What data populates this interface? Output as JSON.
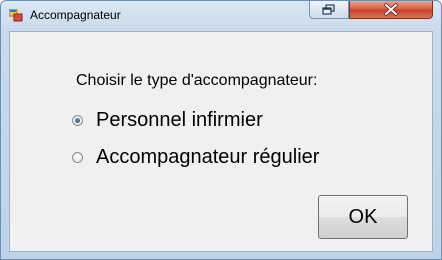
{
  "window": {
    "title": "Accompagnateur",
    "app_icon": "app-window-icon",
    "controls": {
      "restore_icon": "restore-icon",
      "close_icon": "close-icon"
    }
  },
  "dialog": {
    "prompt": "Choisir le type d'accompagnateur:",
    "options": [
      {
        "label": "Personnel infirmier",
        "selected": true
      },
      {
        "label": "Accompagnateur régulier",
        "selected": false
      }
    ],
    "ok_label": "OK"
  },
  "colors": {
    "frame": "#bfd3e8",
    "close_button": "#c2412b",
    "client_background": "#f0f0f0"
  }
}
